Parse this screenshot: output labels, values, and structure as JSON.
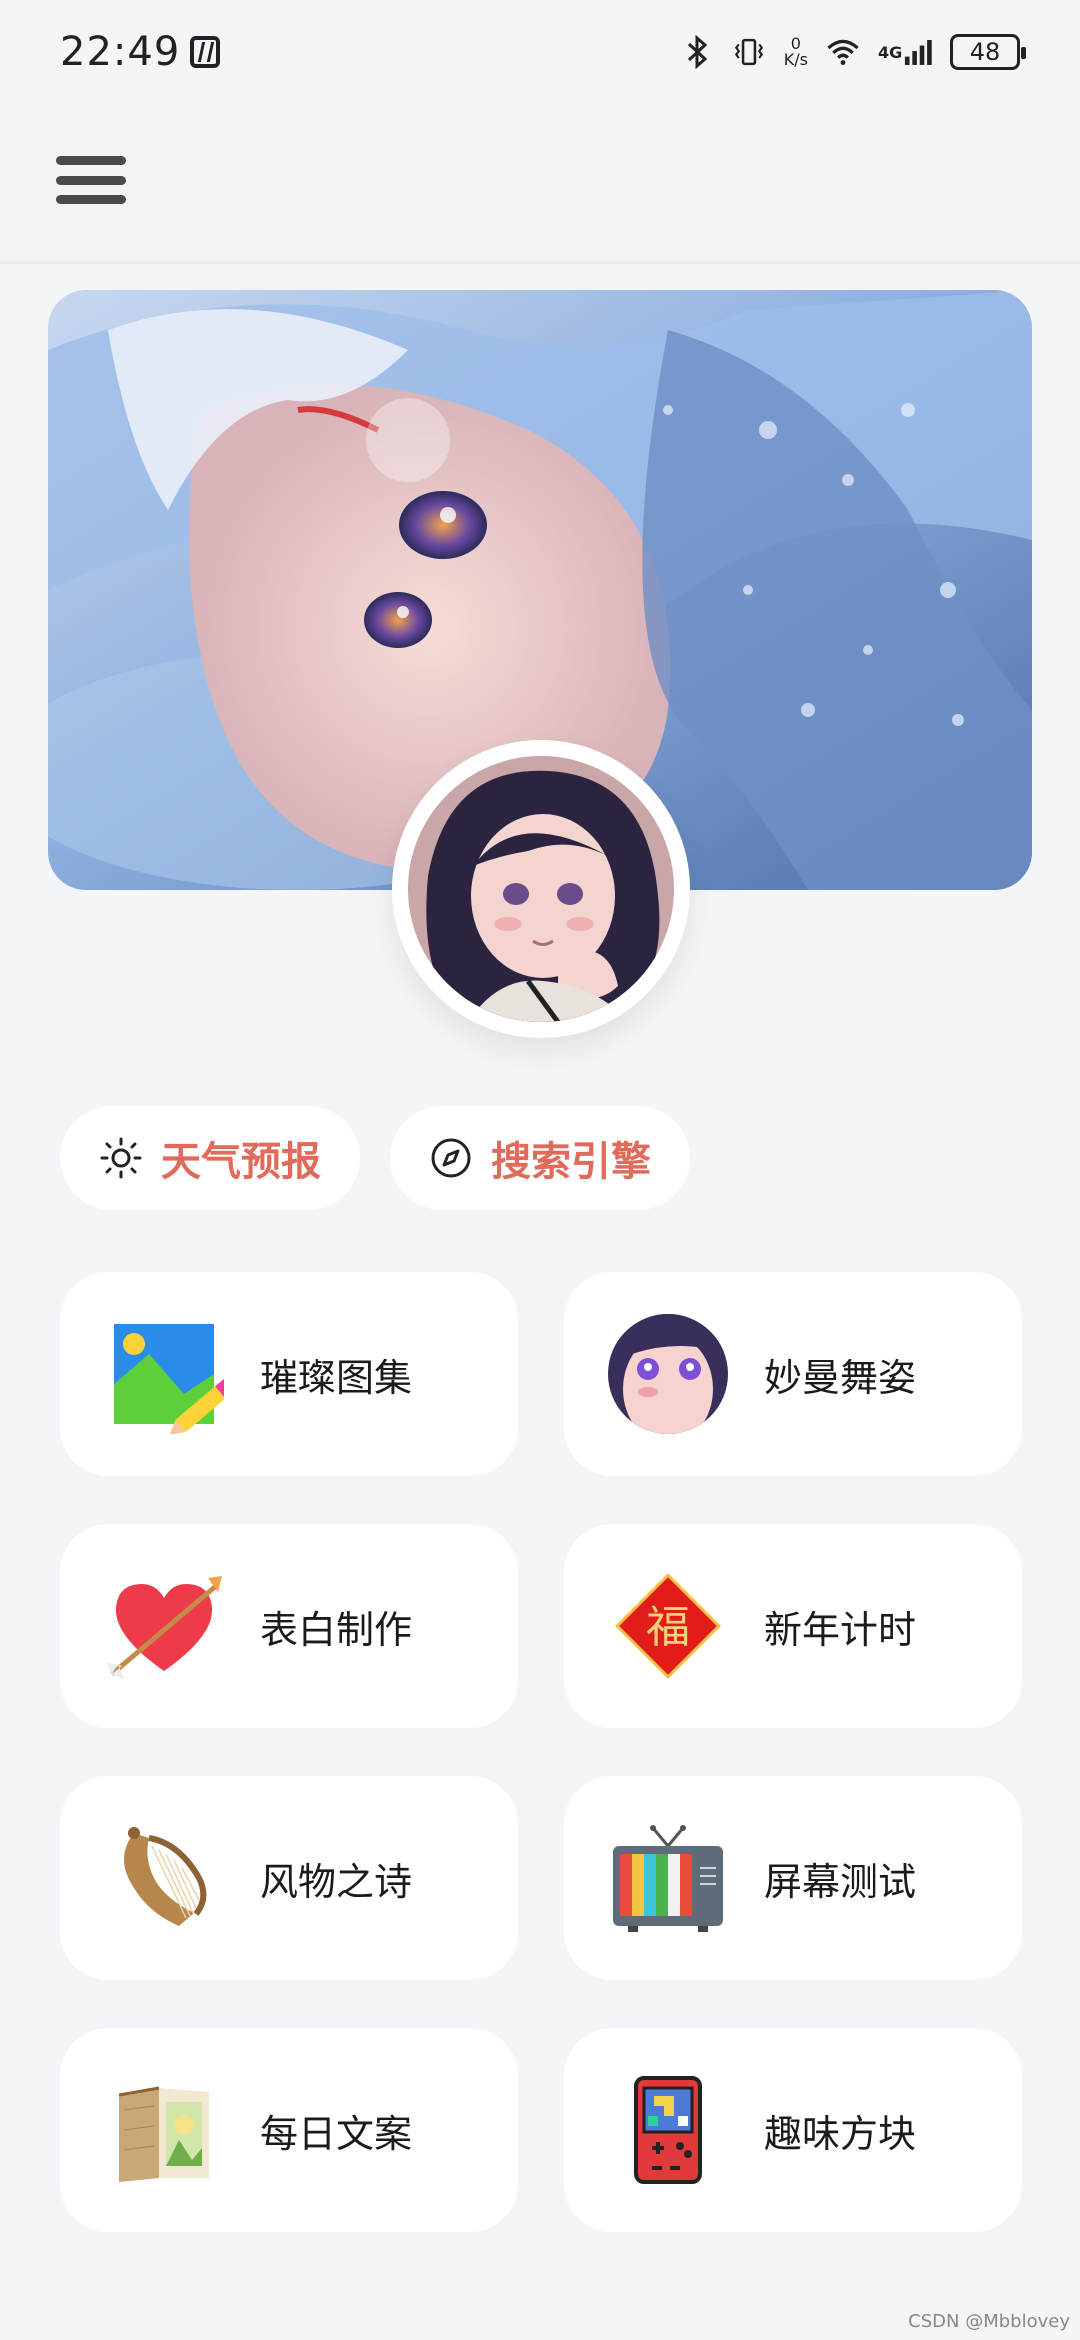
{
  "status_bar": {
    "time": "22:49",
    "net_speed_value": "0",
    "net_speed_unit": "K/s",
    "network": "4G",
    "battery": "48",
    "icons": [
      "nfc-icon",
      "bluetooth-icon",
      "vibrate-icon",
      "wifi-icon",
      "signal-icon",
      "battery-icon"
    ]
  },
  "header": {
    "menu_icon": "hamburger-menu-icon"
  },
  "chips": [
    {
      "label": "天气预报",
      "icon": "sun-icon"
    },
    {
      "label": "搜索引擎",
      "icon": "compass-icon"
    }
  ],
  "grid": [
    {
      "label": "璀璨图集",
      "icon": "gallery-pencil-icon"
    },
    {
      "label": "妙曼舞姿",
      "icon": "anime-face-icon"
    },
    {
      "label": "表白制作",
      "icon": "heart-arrow-icon"
    },
    {
      "label": "新年计时",
      "icon": "fu-diamond-icon"
    },
    {
      "label": "风物之诗",
      "icon": "lyre-icon"
    },
    {
      "label": "屏幕测试",
      "icon": "tv-color-bars-icon"
    },
    {
      "label": "每日文案",
      "icon": "book-icon"
    },
    {
      "label": "趣味方块",
      "icon": "game-console-icon"
    }
  ],
  "fu_character": "福",
  "watermark": "CSDN @Mbblovey",
  "colors": {
    "accent": "#e06b5a",
    "background": "#f4f5f9",
    "card": "#ffffff"
  }
}
